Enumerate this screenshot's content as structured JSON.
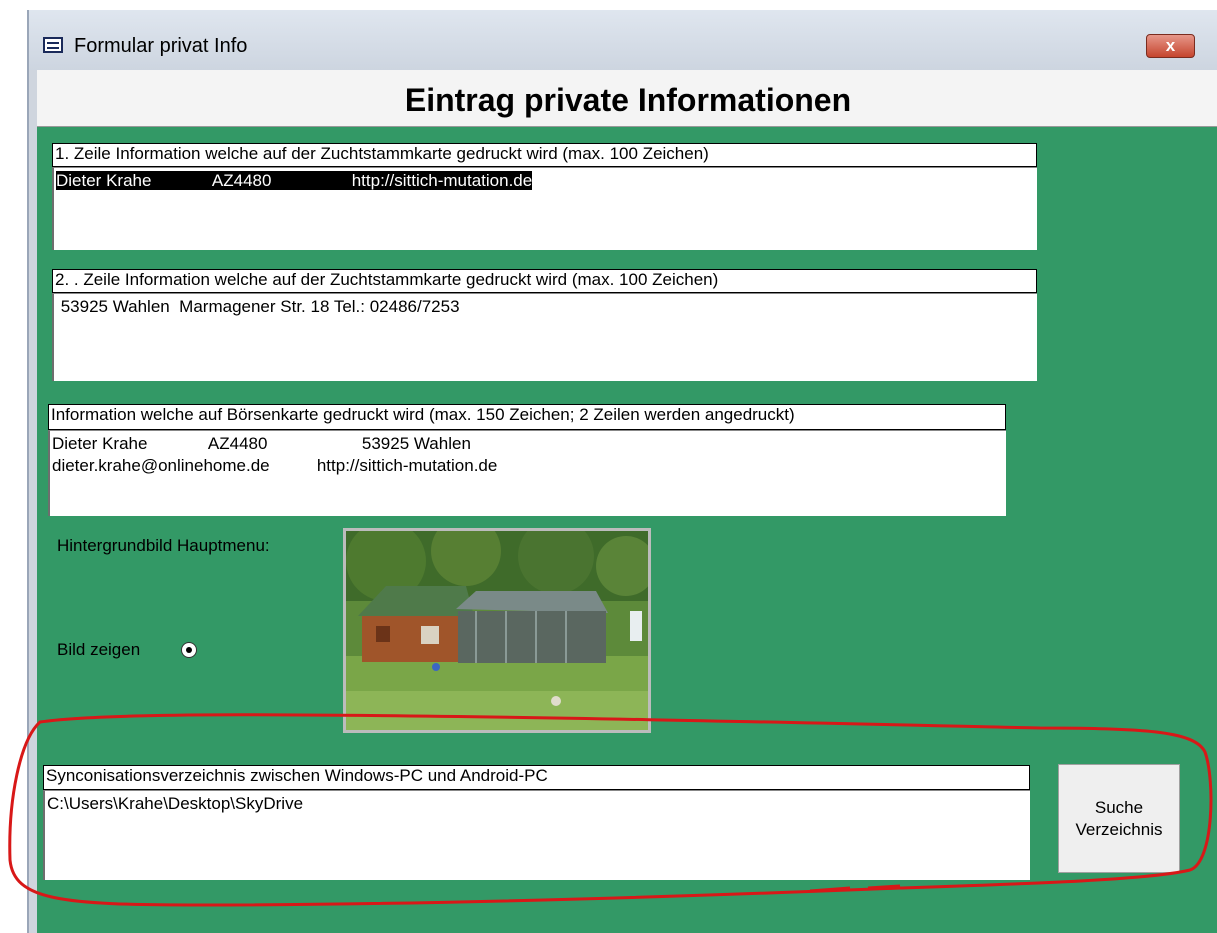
{
  "window": {
    "title": "Formular privat Info",
    "close_label": "x"
  },
  "header": {
    "title": "Eintrag private Informationen"
  },
  "fields": {
    "line1": {
      "label": "1. Zeile Information welche auf der Zuchtstammkarte gedruckt wird  (max. 100 Zeichen)",
      "value": "Dieter Krahe             AZ4480                 http://sittich-mutation.de"
    },
    "line2": {
      "label": "2. . Zeile Information welche auf der Zuchtstammkarte gedruckt wird   (max. 100 Zeichen)",
      "value": " 53925 Wahlen  Marmagener Str. 18 Tel.: 02486/7253"
    },
    "boersen": {
      "label": "Information welche auf Börsenkarte gedruckt wird (max. 150 Zeichen; 2 Zeilen werden angedruckt)",
      "value_line1": "Dieter Krahe             AZ4480                    53925 Wahlen",
      "value_line2": "dieter.krahe@onlinehome.de          http://sittich-mutation.de"
    },
    "sync": {
      "label": "Synconisationsverzeichnis zwischen Windows-PC und Android-PC",
      "value": "C:\\Users\\Krahe\\Desktop\\SkyDrive"
    }
  },
  "background": {
    "label": "Hintergrundbild Hauptmenu:",
    "show_label": "Bild zeigen",
    "show_checked": true
  },
  "buttons": {
    "suche_line1": "Suche",
    "suche_line2": "Verzeichnis"
  },
  "colors": {
    "form_background": "#339966",
    "annotation": "#d81818"
  }
}
